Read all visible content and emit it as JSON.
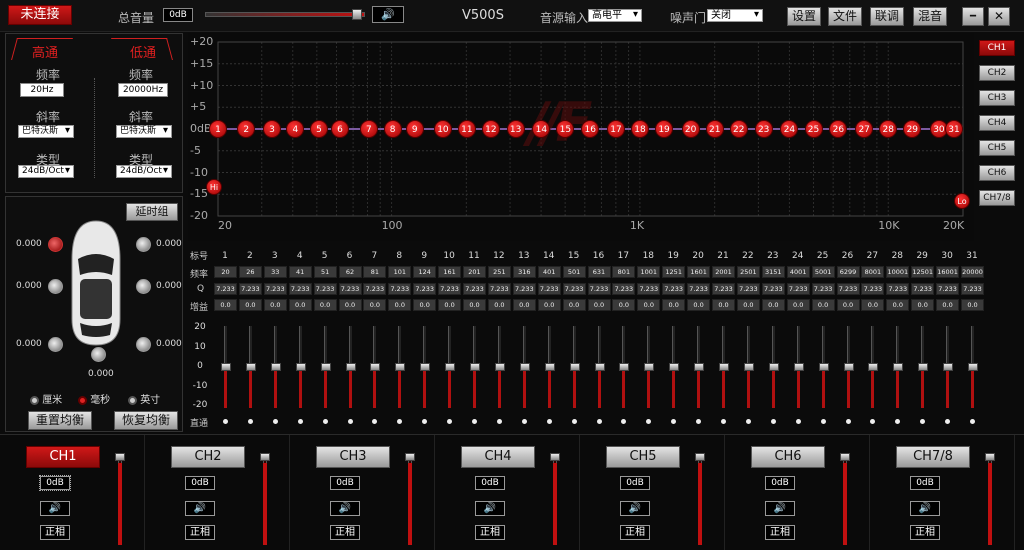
{
  "top": {
    "connect": "未连接",
    "master_label": "总音量",
    "master_value": "0dB",
    "model": "V500S",
    "source_label": "音源输入",
    "source_value": "高电平",
    "noise_label": "噪声门",
    "noise_value": "关闭",
    "settings": "设置",
    "file": "文件",
    "link": "联调",
    "mix": "混音",
    "minimize": "━",
    "close": "✕"
  },
  "crossover": {
    "hp_title": "高通",
    "lp_title": "低通",
    "freq_label": "频率",
    "hp_freq": "20Hz",
    "lp_freq": "20000Hz",
    "slope_label": "斜率",
    "hp_slope": "巴特沃斯",
    "lp_slope": "巴特沃斯",
    "type_label": "类型",
    "hp_type": "24dB/Oct",
    "lp_type": "24dB/Oct"
  },
  "delay": {
    "group_btn": "延时组",
    "values": [
      "0.000",
      "0.000",
      "0.000",
      "0.000",
      "0.000",
      "0.000",
      "0.000"
    ],
    "units": [
      {
        "label": "厘米",
        "on": false
      },
      {
        "label": "毫秒",
        "on": true
      },
      {
        "label": "英寸",
        "on": false
      }
    ],
    "reset_eq": "重置均衡",
    "restore_eq": "恢复均衡"
  },
  "graph": {
    "y_labels": [
      "+20",
      "+15",
      "+10",
      "+5",
      "0dB",
      "-5",
      "-10",
      "-15",
      "-20"
    ],
    "x_labels": [
      "20",
      "100",
      "1K",
      "10K",
      "20K"
    ],
    "hi": "Hi",
    "lo": "Lo"
  },
  "ch_side": [
    "CH1",
    "CH2",
    "CH3",
    "CH4",
    "CH5",
    "CH6",
    "CH7/8"
  ],
  "bands": {
    "row_labels": {
      "num": "标号",
      "freq": "频率",
      "q": "Q",
      "gain": "增益",
      "bypass": "直通"
    },
    "nums": [
      "1",
      "2",
      "3",
      "4",
      "5",
      "6",
      "7",
      "8",
      "9",
      "10",
      "11",
      "12",
      "13",
      "14",
      "15",
      "16",
      "17",
      "18",
      "19",
      "20",
      "21",
      "22",
      "23",
      "24",
      "25",
      "26",
      "27",
      "28",
      "29",
      "30",
      "31"
    ],
    "freqs": [
      "20",
      "26",
      "33",
      "41",
      "51",
      "62",
      "81",
      "101",
      "124",
      "161",
      "201",
      "251",
      "316",
      "401",
      "501",
      "631",
      "801",
      "1001",
      "1251",
      "1601",
      "2001",
      "2501",
      "3151",
      "4001",
      "5001",
      "6299",
      "8001",
      "10001",
      "12501",
      "16001",
      "20000"
    ],
    "q": "7.233",
    "gain": "0.0",
    "gain_scale": [
      "20",
      "10",
      "0",
      "-10",
      "-20"
    ],
    "gain_values": [
      0,
      0,
      0,
      0,
      0,
      0,
      0,
      0,
      0,
      0,
      0,
      0,
      0,
      0,
      0,
      0,
      0,
      0,
      0,
      0,
      0,
      0,
      0,
      0,
      0,
      0,
      0,
      0,
      0,
      0,
      0
    ]
  },
  "channels": [
    {
      "name": "CH1",
      "db": "0dB",
      "phase": "正相",
      "active": true
    },
    {
      "name": "CH2",
      "db": "0dB",
      "phase": "正相",
      "active": false
    },
    {
      "name": "CH3",
      "db": "0dB",
      "phase": "正相",
      "active": false
    },
    {
      "name": "CH4",
      "db": "0dB",
      "phase": "正相",
      "active": false
    },
    {
      "name": "CH5",
      "db": "0dB",
      "phase": "正相",
      "active": false
    },
    {
      "name": "CH6",
      "db": "0dB",
      "phase": "正相",
      "active": false
    },
    {
      "name": "CH7/8",
      "db": "0dB",
      "phase": "正相",
      "active": false
    }
  ],
  "colors": {
    "accent": "#d01818",
    "bg": "#0b0b0b"
  }
}
